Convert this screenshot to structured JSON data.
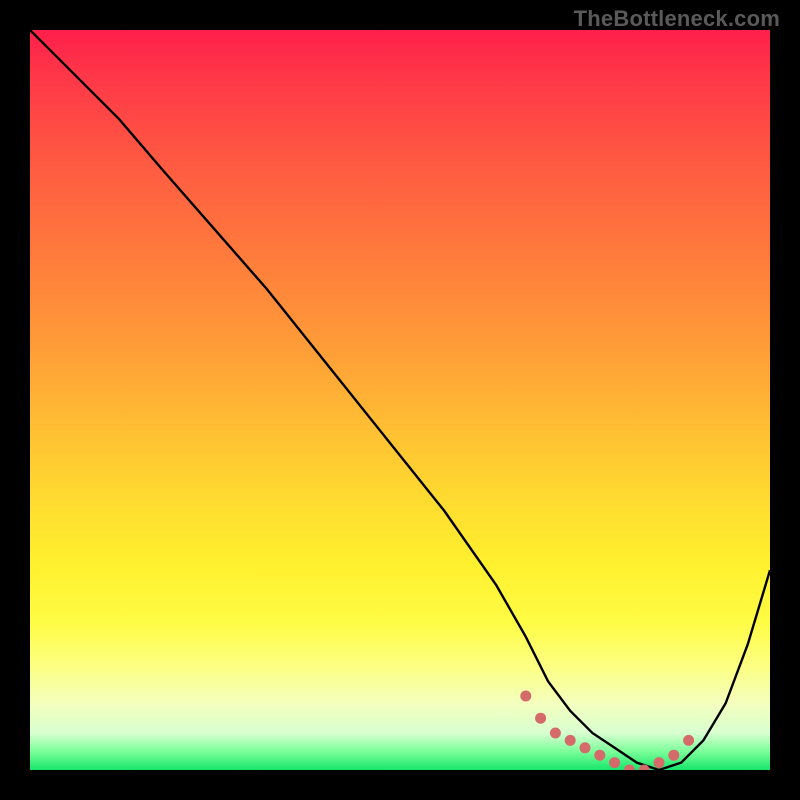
{
  "watermark": "TheBottleneck.com",
  "colors": {
    "background": "#000000",
    "curve": "#000000",
    "marker": "#d46a6a"
  },
  "chart_data": {
    "type": "line",
    "title": "",
    "xlabel": "",
    "ylabel": "",
    "xlim": [
      0,
      100
    ],
    "ylim": [
      0,
      100
    ],
    "grid": false,
    "series": [
      {
        "name": "bottleneck-curve",
        "x": [
          0,
          3,
          7,
          12,
          18,
          25,
          32,
          40,
          48,
          56,
          63,
          67,
          70,
          73,
          76,
          79,
          82,
          85,
          88,
          91,
          94,
          97,
          100
        ],
        "y": [
          100,
          97,
          93,
          88,
          81,
          73,
          65,
          55,
          45,
          35,
          25,
          18,
          12,
          8,
          5,
          3,
          1,
          0,
          1,
          4,
          9,
          17,
          27
        ]
      }
    ],
    "markers": {
      "name": "highlighted-range",
      "x": [
        67,
        69,
        71,
        73,
        75,
        77,
        79,
        81,
        83,
        85,
        87,
        89
      ],
      "y": [
        10,
        7,
        5,
        4,
        3,
        2,
        1,
        0,
        0,
        1,
        2,
        4
      ]
    },
    "gradient_stops": [
      {
        "pos": 0,
        "color": "#ff1f4b"
      },
      {
        "pos": 50,
        "color": "#ffb934"
      },
      {
        "pos": 82,
        "color": "#fffc44"
      },
      {
        "pos": 100,
        "color": "#16e66a"
      }
    ]
  }
}
